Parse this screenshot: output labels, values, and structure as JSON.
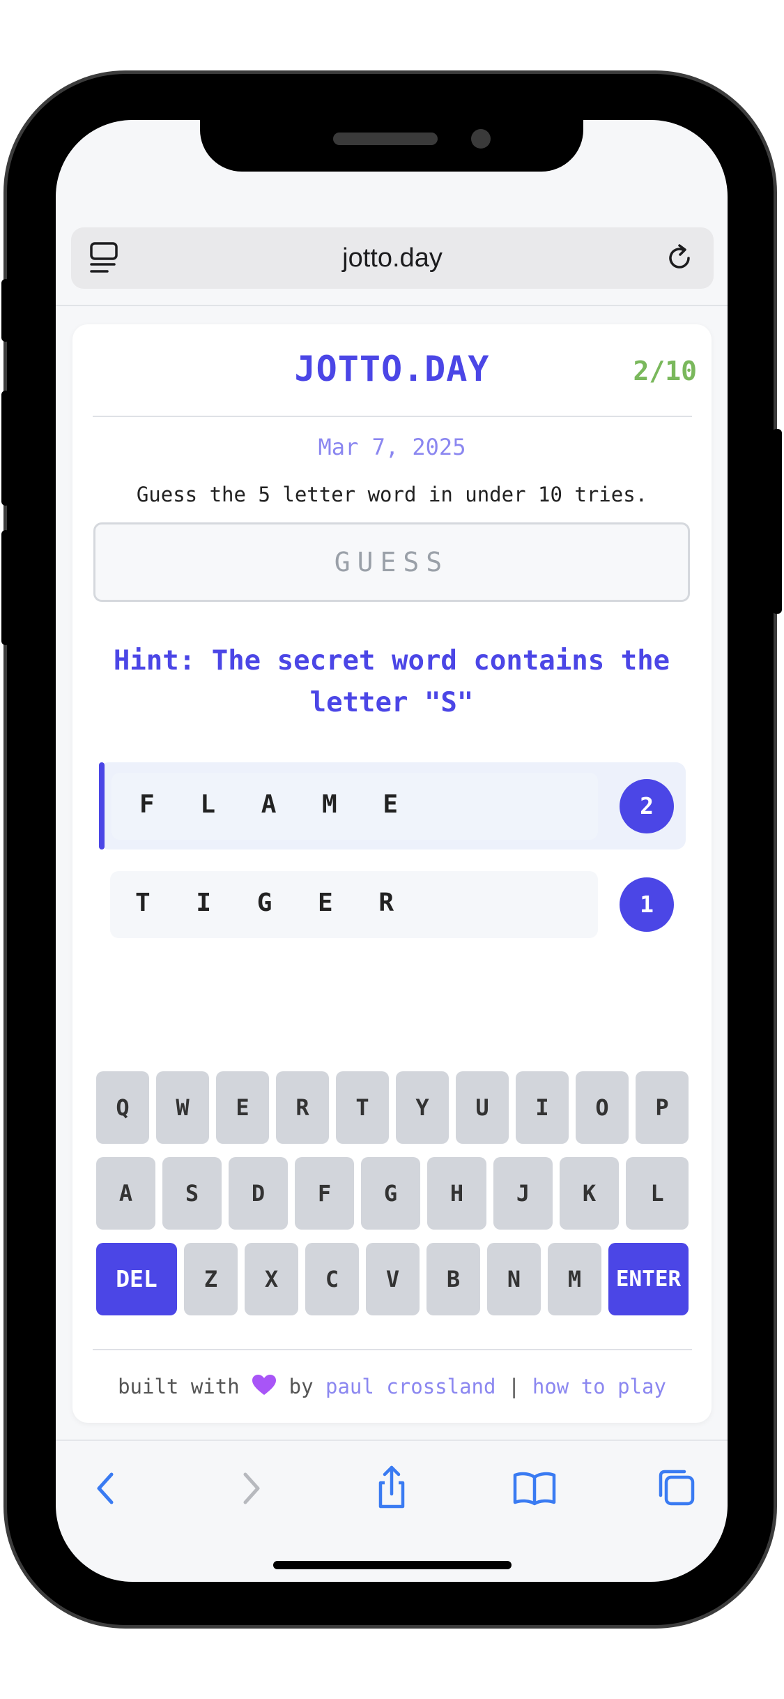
{
  "browser": {
    "url": "jotto.day"
  },
  "app": {
    "title": "JOTTO.DAY",
    "progress": "2/10",
    "date": "Mar 7, 2025",
    "instructions": "Guess the 5 letter word in under 10 tries.",
    "guess_placeholder": "GUESS",
    "hint": "Hint: The secret word contains the letter \"S\""
  },
  "guesses": [
    {
      "word": "F L A M E",
      "score": "2"
    },
    {
      "word": "T I G E R",
      "score": "1"
    }
  ],
  "keyboard": {
    "row1": [
      "Q",
      "W",
      "E",
      "R",
      "T",
      "Y",
      "U",
      "I",
      "O",
      "P"
    ],
    "row2": [
      "A",
      "S",
      "D",
      "F",
      "G",
      "H",
      "J",
      "K",
      "L"
    ],
    "row3": [
      "Z",
      "X",
      "C",
      "V",
      "B",
      "N",
      "M"
    ],
    "delete_label": "DEL",
    "enter_label": "ENTER"
  },
  "footer": {
    "built_with": "built with",
    "by": "by",
    "author": "paul crossland",
    "separator": "|",
    "how_to_play": "how to play"
  },
  "colors": {
    "accent": "#4b46e6",
    "progress": "#7ab85c",
    "link": "#8b87f0",
    "key": "#d2d5db"
  },
  "icons": {
    "tabs": "tabs-icon",
    "reload": "reload-icon",
    "back": "chevron-left-icon",
    "forward": "chevron-right-icon",
    "share": "share-icon",
    "bookmarks": "book-icon",
    "tab_overview": "tabs-overview-icon",
    "heart": "purple-heart-icon"
  }
}
